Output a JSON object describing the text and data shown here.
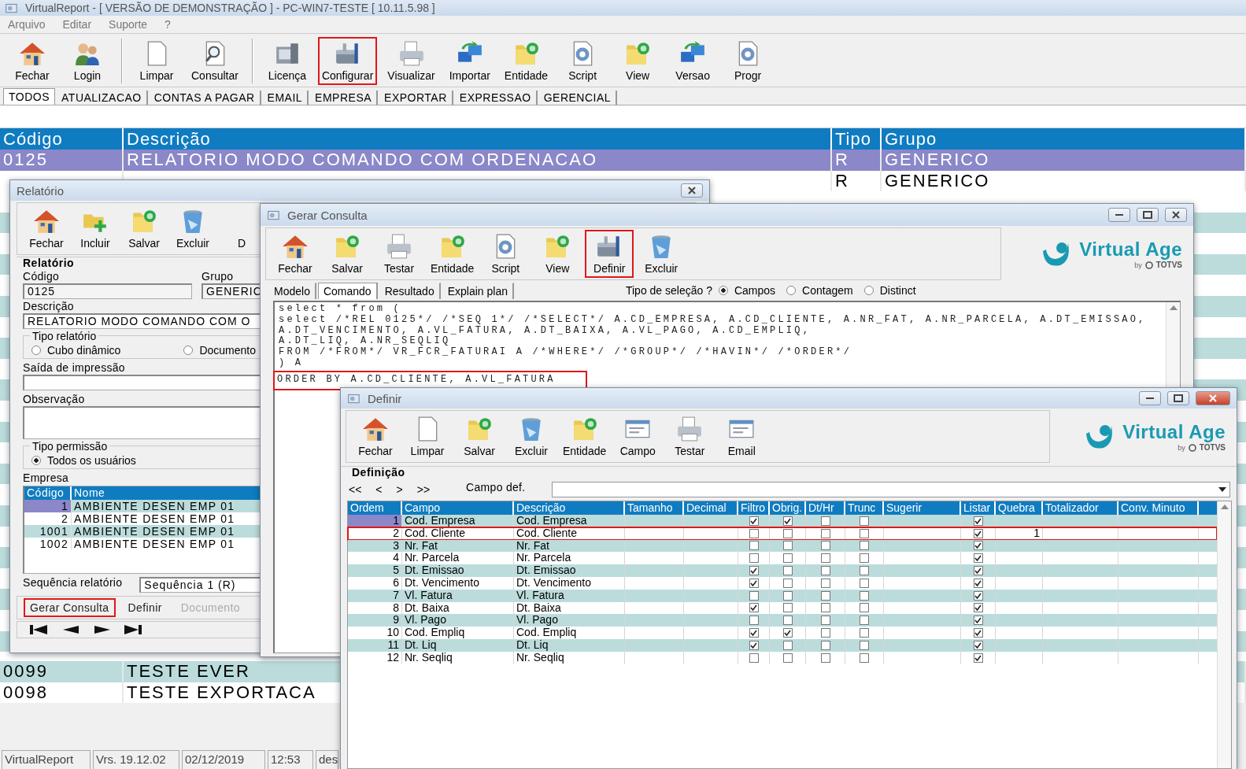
{
  "window": {
    "title": "VirtualReport - [ VERSÃO DE DEMONSTRAÇÃO ] - PC-WIN7-TESTE [ 10.11.5.98 ]"
  },
  "menu": [
    "Arquivo",
    "Editar",
    "Suporte",
    "?"
  ],
  "toolbar": [
    {
      "label": "Fechar",
      "highlighted": false,
      "separator_before": false
    },
    {
      "label": "Login",
      "highlighted": false,
      "separator_before": false
    },
    {
      "label": "Limpar",
      "highlighted": false,
      "separator_before": true
    },
    {
      "label": "Consultar",
      "highlighted": false,
      "separator_before": false
    },
    {
      "label": "Licença",
      "highlighted": false,
      "separator_before": true
    },
    {
      "label": "Configurar",
      "highlighted": true,
      "separator_before": false
    },
    {
      "label": "Visualizar",
      "highlighted": false,
      "separator_before": false
    },
    {
      "label": "Importar",
      "highlighted": false,
      "separator_before": false
    },
    {
      "label": "Entidade",
      "highlighted": false,
      "separator_before": false
    },
    {
      "label": "Script",
      "highlighted": false,
      "separator_before": false
    },
    {
      "label": "View",
      "highlighted": false,
      "separator_before": false
    },
    {
      "label": "Versao",
      "highlighted": false,
      "separator_before": false
    },
    {
      "label": "Progr",
      "highlighted": false,
      "separator_before": false
    }
  ],
  "tabs": [
    {
      "label": "TODOS",
      "selected": true
    },
    {
      "label": "ATUALIZACAO",
      "selected": false
    },
    {
      "label": "CONTAS A PAGAR",
      "selected": false
    },
    {
      "label": "EMAIL",
      "selected": false
    },
    {
      "label": "EMPRESA",
      "selected": false
    },
    {
      "label": "EXPORTAR",
      "selected": false
    },
    {
      "label": "EXPRESSAO",
      "selected": false
    },
    {
      "label": "GERENCIAL",
      "selected": false
    }
  ],
  "table": {
    "columns": [
      "Código",
      "Descrição",
      "Tipo",
      "Grupo"
    ],
    "rows": [
      {
        "codigo": "0125",
        "descricao": "RELATORIO MODO COMANDO COM ORDENACAO",
        "tipo": "R",
        "grupo": "GENERICO",
        "selected": true
      },
      {
        "tipo": "R",
        "grupo": "GENERICO",
        "selected": false
      }
    ],
    "rows_after_covered": [
      {
        "codigo": "0099",
        "descricao": "TESTE EVER",
        "selected": false
      },
      {
        "codigo": "0098",
        "descricao": "TESTE EXPORTACA",
        "selected": false
      }
    ]
  },
  "status_bar": [
    "VirtualReport",
    "Vrs. 19.12.02",
    "02/12/2019",
    "12:53",
    "des"
  ],
  "relatorio": {
    "title": "Relatório",
    "toolbar": [
      {
        "label": "Fechar",
        "highlighted": false
      },
      {
        "label": "Incluir",
        "highlighted": false
      },
      {
        "label": "Salvar",
        "highlighted": false
      },
      {
        "label": "Excluir",
        "highlighted": false
      },
      {
        "label": "D",
        "highlighted": false
      }
    ],
    "group": "Relatório",
    "codigo_label": "Código",
    "codigo": "0125",
    "grupo_label": "Grupo",
    "grupo": "GENERIC",
    "descricao_label": "Descrição",
    "descricao": "RELATORIO MODO COMANDO COM O",
    "tipo_relatorio": {
      "label": "Tipo relatório",
      "options": [
        {
          "label": "Cubo dinâmico",
          "selected": false
        },
        {
          "label": "Documento",
          "selected": false
        }
      ]
    },
    "saida_label": "Saída de impressão",
    "observacao_label": "Observação",
    "tipo_permissao": {
      "label": "Tipo permissão",
      "options": [
        {
          "label": "Todos os usuários",
          "selected": true
        }
      ]
    },
    "empresa": {
      "label": "Empresa",
      "columns": [
        "Código",
        "Nome"
      ],
      "rows": [
        {
          "codigo": "1",
          "nome": "AMBIENTE DESEN  EMP 01",
          "selected": true
        },
        {
          "codigo": "2",
          "nome": "AMBIENTE DESEN  EMP 01",
          "selected": false
        },
        {
          "codigo": "1001",
          "nome": "AMBIENTE DESEN  EMP 01",
          "selected": false
        },
        {
          "codigo": "1002",
          "nome": "AMBIENTE DESEN  EMP 01",
          "selected": false
        }
      ]
    },
    "sequencia_label": "Sequência relatório",
    "sequencia": "Sequência 1 (R)",
    "actions": [
      {
        "label": "Gerar Consulta",
        "highlighted": true,
        "disabled": false
      },
      {
        "label": "Definir",
        "highlighted": false,
        "disabled": false
      },
      {
        "label": "Documento",
        "highlighted": false,
        "disabled": true
      }
    ]
  },
  "gerar_consulta": {
    "title": "Gerar Consulta",
    "toolbar": [
      {
        "label": "Fechar",
        "highlighted": false
      },
      {
        "label": "Salvar",
        "highlighted": false
      },
      {
        "label": "Testar",
        "highlighted": false
      },
      {
        "label": "Entidade",
        "highlighted": false
      },
      {
        "label": "Script",
        "highlighted": false
      },
      {
        "label": "View",
        "highlighted": false
      },
      {
        "label": "Definir",
        "highlighted": true
      },
      {
        "label": "Excluir",
        "highlighted": false
      }
    ],
    "logo": {
      "name": "Virtual Age",
      "by": "by",
      "brand": "TOTVS"
    },
    "tabs": [
      {
        "label": "Modelo",
        "selected": false
      },
      {
        "label": "Comando",
        "selected": true
      },
      {
        "label": "Resultado",
        "selected": false
      },
      {
        "label": "Explain plan",
        "selected": false
      }
    ],
    "selection_label": "Tipo de seleção ?",
    "selection": [
      {
        "label": "Campos",
        "selected": true
      },
      {
        "label": "Contagem",
        "selected": false
      },
      {
        "label": "Distinct",
        "selected": false
      }
    ],
    "sql": [
      {
        "text": "select * from (",
        "highlighted": false
      },
      {
        "text": "select /*REL 0125*/ /*SEQ 1*/ /*SELECT*/ A.CD_EMPRESA, A.CD_CLIENTE, A.NR_FAT, A.NR_PARCELA, A.DT_EMISSAO,",
        "highlighted": false
      },
      {
        "text": "A.DT_VENCIMENTO, A.VL_FATURA, A.DT_BAIXA, A.VL_PAGO, A.CD_EMPLIQ,",
        "highlighted": false
      },
      {
        "text": "A.DT_LIQ, A.NR_SEQLIQ",
        "highlighted": false
      },
      {
        "text": "FROM /*FROM*/ VR_FCR_FATURAI A /*WHERE*/ /*GROUP*/ /*HAVIN*/ /*ORDER*/",
        "highlighted": false
      },
      {
        "text": ") A",
        "highlighted": false
      },
      {
        "text": "ORDER BY A.CD_CLIENTE, A.VL_FATURA",
        "highlighted": true
      }
    ]
  },
  "definir": {
    "title": "Definir",
    "toolbar": [
      {
        "label": "Fechar",
        "highlighted": false
      },
      {
        "label": "Limpar",
        "highlighted": false
      },
      {
        "label": "Salvar",
        "highlighted": false
      },
      {
        "label": "Excluir",
        "highlighted": false
      },
      {
        "label": "Entidade",
        "highlighted": false
      },
      {
        "label": "Campo",
        "highlighted": false
      },
      {
        "label": "Testar",
        "highlighted": false
      },
      {
        "label": "Email",
        "highlighted": false
      }
    ],
    "logo": {
      "name": "Virtual Age",
      "by": "by",
      "brand": "TOTVS"
    },
    "group": "Definição",
    "nav": [
      "<<",
      "<",
      ">",
      ">>"
    ],
    "campo_def_label": "Campo def.",
    "columns": [
      "Ordem",
      "Campo",
      "Descrição",
      "Tamanho",
      "Decimal",
      "Filtro",
      "Obrig.",
      "Dt/Hr",
      "Trunc",
      "Sugerir",
      "Listar",
      "Quebra",
      "Totalizador",
      "Conv. Minuto"
    ],
    "rows": [
      {
        "ordem": "1",
        "campo": "Cod. Empresa",
        "descricao": "Cod. Empresa",
        "filtro": true,
        "obrig": true,
        "dthr": false,
        "trunc": false,
        "listar": true,
        "selected": true,
        "highlighted": false
      },
      {
        "ordem": "2",
        "campo": "Cod. Cliente",
        "descricao": "Cod. Cliente",
        "filtro": false,
        "obrig": false,
        "dthr": false,
        "trunc": false,
        "listar": true,
        "quebra": "1",
        "selected": false,
        "highlighted": true
      },
      {
        "ordem": "3",
        "campo": "Nr. Fat",
        "descricao": "Nr. Fat",
        "filtro": false,
        "obrig": false,
        "dthr": false,
        "trunc": false,
        "listar": true,
        "selected": false,
        "highlighted": false
      },
      {
        "ordem": "4",
        "campo": "Nr. Parcela",
        "descricao": "Nr. Parcela",
        "filtro": false,
        "obrig": false,
        "dthr": false,
        "trunc": false,
        "listar": true,
        "selected": false,
        "highlighted": false
      },
      {
        "ordem": "5",
        "campo": "Dt. Emissao",
        "descricao": "Dt. Emissao",
        "filtro": true,
        "obrig": false,
        "dthr": false,
        "trunc": false,
        "listar": true,
        "selected": false,
        "highlighted": false
      },
      {
        "ordem": "6",
        "campo": "Dt. Vencimento",
        "descricao": "Dt. Vencimento",
        "filtro": true,
        "obrig": false,
        "dthr": false,
        "trunc": false,
        "listar": true,
        "selected": false,
        "highlighted": false
      },
      {
        "ordem": "7",
        "campo": "Vl. Fatura",
        "descricao": "Vl. Fatura",
        "filtro": false,
        "obrig": false,
        "dthr": false,
        "trunc": false,
        "listar": true,
        "selected": false,
        "highlighted": false
      },
      {
        "ordem": "8",
        "campo": "Dt. Baixa",
        "descricao": "Dt. Baixa",
        "filtro": true,
        "obrig": false,
        "dthr": false,
        "trunc": false,
        "listar": true,
        "selected": false,
        "highlighted": false
      },
      {
        "ordem": "9",
        "campo": "Vl. Pago",
        "descricao": "Vl. Pago",
        "filtro": false,
        "obrig": false,
        "dthr": false,
        "trunc": false,
        "listar": true,
        "selected": false,
        "highlighted": false
      },
      {
        "ordem": "10",
        "campo": "Cod. Empliq",
        "descricao": "Cod. Empliq",
        "filtro": true,
        "obrig": true,
        "dthr": false,
        "trunc": false,
        "listar": true,
        "selected": false,
        "highlighted": false
      },
      {
        "ordem": "11",
        "campo": "Dt. Liq",
        "descricao": "Dt. Liq",
        "filtro": true,
        "obrig": false,
        "dthr": false,
        "trunc": false,
        "listar": true,
        "selected": false,
        "highlighted": false
      },
      {
        "ordem": "12",
        "campo": "Nr. Seqliq",
        "descricao": "Nr. Seqliq",
        "filtro": false,
        "obrig": false,
        "dthr": false,
        "trunc": false,
        "listar": true,
        "selected": false,
        "highlighted": false
      }
    ]
  }
}
